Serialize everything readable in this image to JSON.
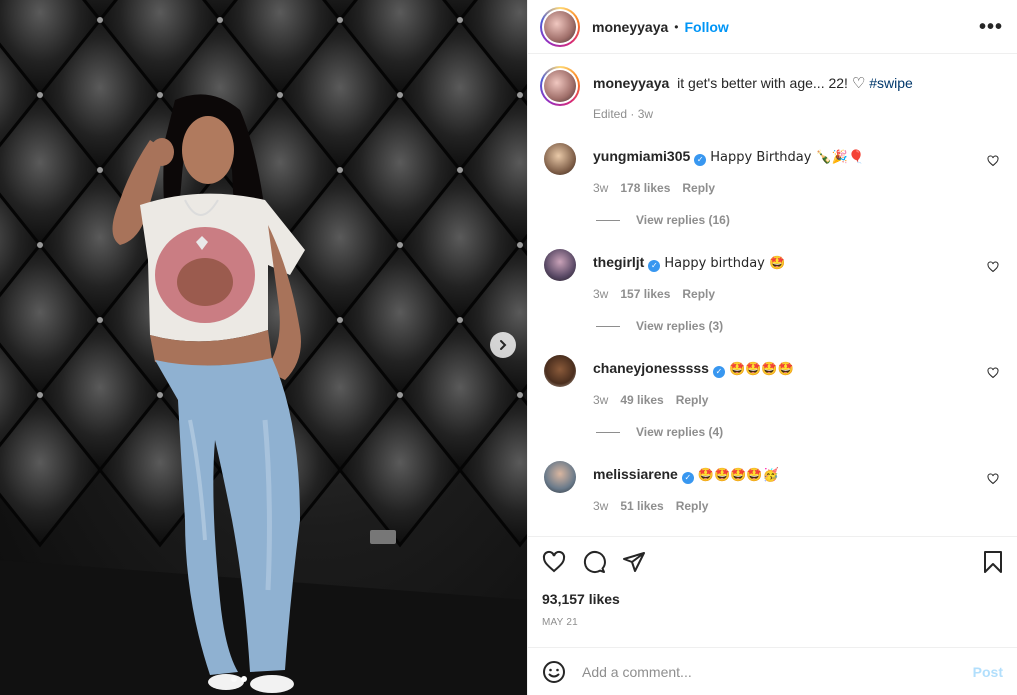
{
  "header": {
    "username": "moneyyaya",
    "separator": "•",
    "follow_label": "Follow",
    "more_label": "•••"
  },
  "caption": {
    "username": "moneyyaya",
    "text": "it get's better with age... 22!",
    "heart_emoji": "♡",
    "hashtag": "#swipe",
    "meta": "Edited · 3w"
  },
  "comments": [
    {
      "username": "yungmiami305",
      "verified": true,
      "text": "Happy Birthday 🍾🎉🎈",
      "age": "3w",
      "likes": "178 likes",
      "reply_label": "Reply",
      "view_replies": "View replies (16)"
    },
    {
      "username": "thegirljt",
      "verified": true,
      "text": "Happy birthday 🤩",
      "age": "3w",
      "likes": "157 likes",
      "reply_label": "Reply",
      "view_replies": "View replies (3)"
    },
    {
      "username": "chaneyjonesssss",
      "verified": true,
      "text": "🤩🤩🤩🤩",
      "age": "3w",
      "likes": "49 likes",
      "reply_label": "Reply",
      "view_replies": "View replies (4)"
    },
    {
      "username": "melissiarene",
      "verified": true,
      "text": "🤩🤩🤩🤩🥳",
      "age": "3w",
      "likes": "51 likes",
      "reply_label": "Reply"
    }
  ],
  "post": {
    "likes": "93,157 likes",
    "date": "MAY 21"
  },
  "add_comment": {
    "placeholder": "Add a comment...",
    "post_label": "Post"
  },
  "carousel": {
    "count": 2,
    "active_index": 1
  },
  "colors": {
    "accent": "#0095f6",
    "verified": "#3897f0",
    "muted": "#8e8e8e"
  }
}
